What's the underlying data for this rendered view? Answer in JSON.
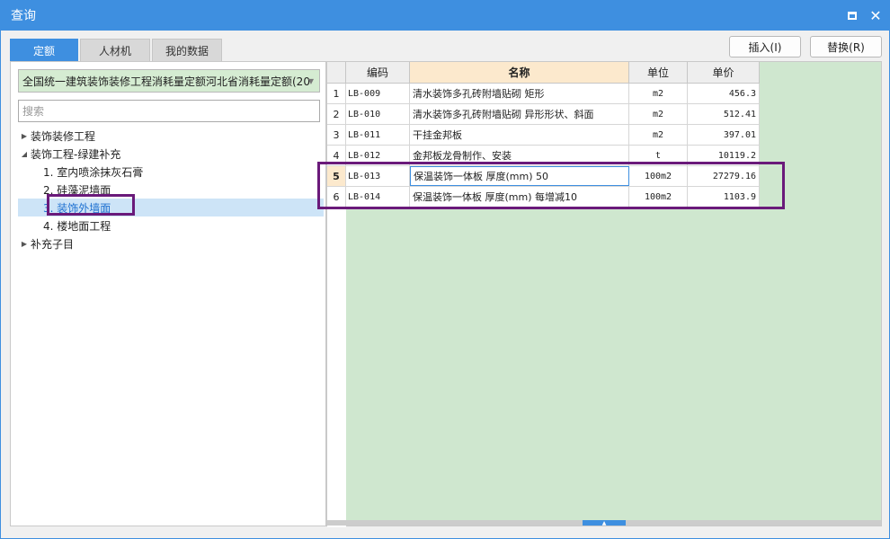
{
  "window": {
    "title": "查询"
  },
  "tabs": [
    {
      "label": "定额"
    },
    {
      "label": "人材机"
    },
    {
      "label": "我的数据"
    }
  ],
  "buttons": {
    "insert": "插入(I)",
    "replace": "替换(R)"
  },
  "library": {
    "selected": "全国统一建筑装饰装修工程消耗量定额河北省消耗量定额(20"
  },
  "search": {
    "placeholder": "搜索"
  },
  "tree": [
    {
      "label": "装饰装修工程"
    },
    {
      "label": "装饰工程-绿建补充"
    },
    {
      "label": "1. 室内喷涂抹灰石膏"
    },
    {
      "label": "2. 硅藻泥墙面"
    },
    {
      "label": "3. 装饰外墙面"
    },
    {
      "label": "4. 楼地面工程"
    },
    {
      "label": "补充子目"
    }
  ],
  "grid": {
    "columns": [
      "",
      "编码",
      "名称",
      "单位",
      "单价"
    ],
    "rows": [
      {
        "num": "1",
        "code": "LB-009",
        "name": "清水装饰多孔砖附墙贴砌 矩形",
        "unit": "m2",
        "price": "456.3"
      },
      {
        "num": "2",
        "code": "LB-010",
        "name": "清水装饰多孔砖附墙贴砌 异形形状、斜面",
        "unit": "m2",
        "price": "512.41"
      },
      {
        "num": "3",
        "code": "LB-011",
        "name": "干挂金邦板",
        "unit": "m2",
        "price": "397.01"
      },
      {
        "num": "4",
        "code": "LB-012",
        "name": "金邦板龙骨制作、安装",
        "unit": "t",
        "price": "10119.2"
      },
      {
        "num": "5",
        "code": "LB-013",
        "name": "保温装饰一体板 厚度(mm) 50",
        "unit": "100m2",
        "price": "27279.16"
      },
      {
        "num": "6",
        "code": "LB-014",
        "name": "保温装饰一体板 厚度(mm) 每增减10",
        "unit": "100m2",
        "price": "1103.9"
      }
    ]
  },
  "colors": {
    "accent": "#3e8fe0",
    "highlight": "#6a1a7a",
    "grid_bg": "#cfe7cf",
    "header_hl": "#fce9cd"
  }
}
